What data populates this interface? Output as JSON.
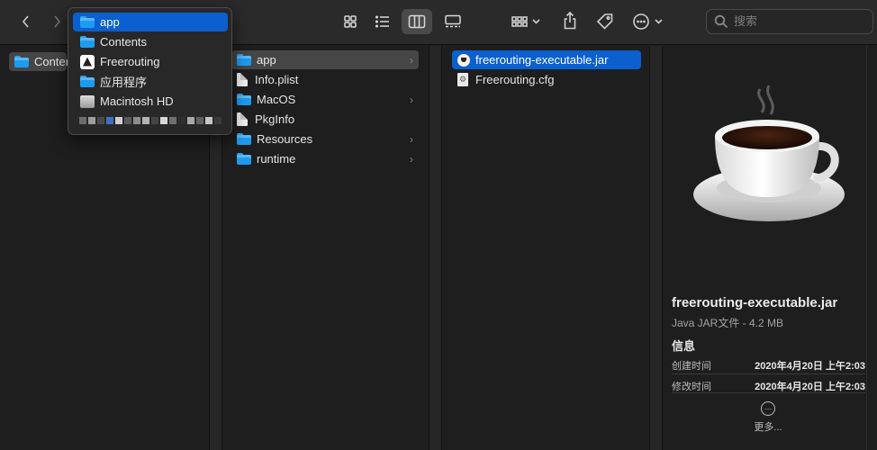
{
  "toolbar": {
    "back_icon": "chevron-left",
    "forward_icon": "chevron-right",
    "view_modes": [
      "icon-grid",
      "list",
      "columns",
      "gallery"
    ],
    "active_view": "columns",
    "group_icon": "group-grid",
    "share_icon": "share",
    "tag_icon": "tag",
    "more_icon": "ellipsis-circle",
    "search_placeholder": "搜索"
  },
  "popup": {
    "items": [
      {
        "label": "app",
        "icon": "folder-icon",
        "active": true
      },
      {
        "label": "Contents",
        "icon": "folder-icon",
        "active": false
      },
      {
        "label": "Freerouting",
        "icon": "app-icon",
        "active": false
      },
      {
        "label": "应用程序",
        "icon": "folder-icon",
        "active": false
      },
      {
        "label": "Macintosh HD",
        "icon": "hard-drive-icon",
        "active": false
      }
    ],
    "redacted_colors": [
      "#6d6d6d",
      "#9d9d9d",
      "#4b4b4b",
      "#3f6fc9",
      "#cfcfcf",
      "#5a5a5a",
      "#8c8c8c",
      "#b4b4b4",
      "#444444",
      "#d7d7d7",
      "#707070",
      "#2f2f2f",
      "#a8a8a8",
      "#616161",
      "#c6c6c6",
      "#3a3a3a"
    ]
  },
  "column1": {
    "items": [
      {
        "label": "Contents",
        "icon": "folder-icon",
        "selected": "grey"
      }
    ]
  },
  "column2": {
    "items": [
      {
        "label": "app",
        "icon": "folder-icon",
        "has_children": true,
        "selected": "grey"
      },
      {
        "label": "Info.plist",
        "icon": "document-icon",
        "has_children": false,
        "selected": ""
      },
      {
        "label": "MacOS",
        "icon": "folder-icon",
        "has_children": true,
        "selected": ""
      },
      {
        "label": "PkgInfo",
        "icon": "document-icon",
        "has_children": false,
        "selected": ""
      },
      {
        "label": "Resources",
        "icon": "folder-icon",
        "has_children": true,
        "selected": ""
      },
      {
        "label": "runtime",
        "icon": "folder-icon",
        "has_children": true,
        "selected": ""
      }
    ],
    "chevron": "›"
  },
  "column3": {
    "items": [
      {
        "label": "freerouting-executable.jar",
        "icon": "jar-icon",
        "selected": "blue"
      },
      {
        "label": "Freerouting.cfg",
        "icon": "config-file-icon",
        "selected": ""
      }
    ]
  },
  "preview": {
    "file_name": "freerouting-executable.jar",
    "subtitle": "Java JAR文件 - 4.2 MB",
    "info_heading": "信息",
    "info_rows": [
      {
        "key": "创建时间",
        "value": "2020年4月20日 上午2:03"
      },
      {
        "key": "修改时间",
        "value": "2020年4月20日 上午2:03"
      }
    ],
    "more_label": "更多...",
    "more_icon_glyph": "···"
  },
  "colors": {
    "accent_blue": "#0b5fce",
    "folder_blue": "#1d9bf0",
    "window_bg": "#1e1e1e",
    "toolbar_bg": "#2a2a2a"
  }
}
